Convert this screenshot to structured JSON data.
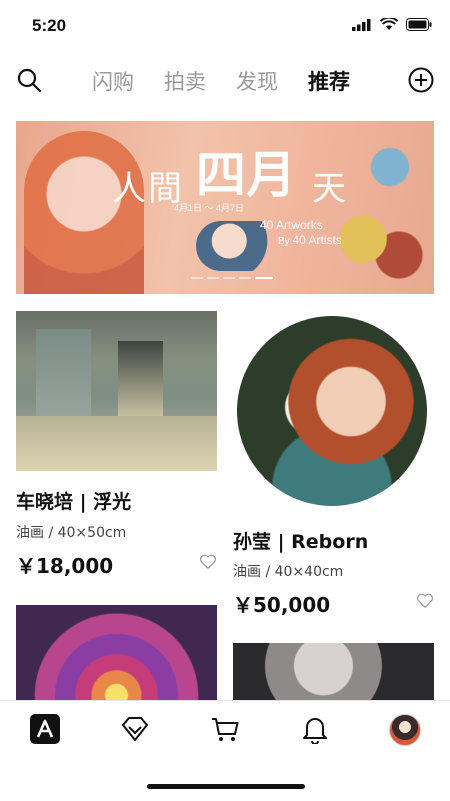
{
  "status": {
    "time": "5:20"
  },
  "nav": {
    "tabs": [
      {
        "label": "闪购",
        "active": false
      },
      {
        "label": "拍卖",
        "active": false
      },
      {
        "label": "发现",
        "active": false
      },
      {
        "label": "推荐",
        "active": true
      }
    ]
  },
  "banner": {
    "title_left": "人間",
    "title_main": "四月",
    "title_right": "天",
    "dates": "4月1日 ～ 4月7日",
    "artworks": "40 Artworks",
    "by": "By",
    "artists": "40 Artists",
    "page_index": 5,
    "page_count": 5
  },
  "artworks": [
    {
      "title": "车晓培 | 浮光",
      "meta": "油画 / 40×50cm",
      "price": "￥18,000"
    },
    {
      "title": "孙莹 | Reborn",
      "meta": "油画 / 40×40cm",
      "price": "￥50,000"
    }
  ],
  "tabbar": {
    "items": [
      "app-logo-icon",
      "diamond-icon",
      "cart-icon",
      "bell-icon",
      "avatar"
    ]
  },
  "colors": {
    "accent": "#111111",
    "inactive_tab": "#9a9a9a",
    "banner_bg": "#efb59c"
  }
}
